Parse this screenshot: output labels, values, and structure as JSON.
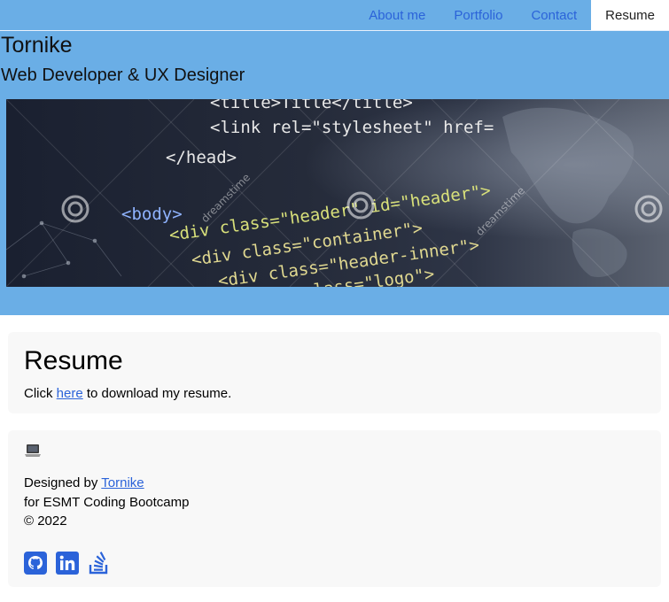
{
  "nav": {
    "items": [
      "About me",
      "Portfolio",
      "Contact",
      "Resume"
    ],
    "active": "Resume"
  },
  "header": {
    "title": "Tornike",
    "subtitle": "Web Developer & UX Designer"
  },
  "banner": {
    "code_lines": [
      "<title>Title</title>",
      "<link rel=\"stylesheet\" href=",
      "</head>",
      "<body>",
      "<div class=\"header\" id=\"header\">",
      "<div class=\"container\">",
      "<div class=\"header-inner\">",
      "<div class=\"logo\">"
    ],
    "watermark": "dreamstime"
  },
  "resume": {
    "title": "Resume",
    "text_before": "Click ",
    "link_text": "here",
    "text_after": " to download my resume."
  },
  "footer": {
    "designed_by_prefix": "Designed by ",
    "designer_link": "Tornike",
    "bootcamp": "for ESMT Coding Bootcamp",
    "copyright": "© 2022",
    "social_icons": [
      "github-icon",
      "linkedin-icon",
      "stackoverflow-icon"
    ]
  },
  "colors": {
    "header_bg": "#6aaee6",
    "link": "#2b63d9",
    "card_bg": "#f8f8f8"
  }
}
